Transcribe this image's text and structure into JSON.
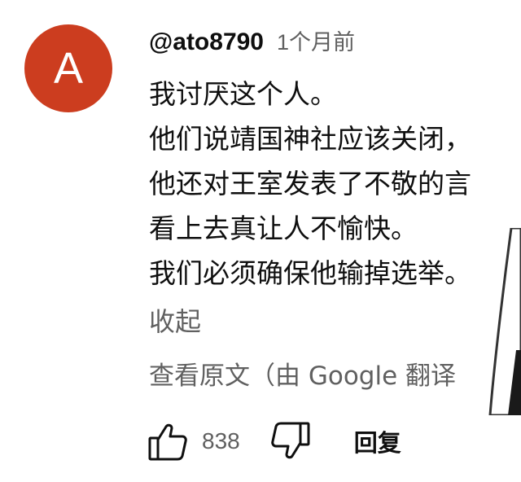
{
  "comment": {
    "avatar_letter": "A",
    "username": "@ato8790",
    "timestamp": "1个月前",
    "lines": [
      "我讨厌这个人。",
      "他们说靖国神社应该关闭，",
      "他还对王室发表了不敬的言",
      "看上去真让人不愉快。",
      "我们必须确保他输掉选举。"
    ],
    "collapse_label": "收起",
    "translate_label": "查看原文（由 Google 翻译",
    "like_count": "838",
    "reply_label": "回复"
  },
  "colors": {
    "avatar_bg": "#cc3d1f",
    "primary_text": "#0f0f0f",
    "secondary_text": "#606060"
  },
  "icons": [
    "thumbs-up-icon",
    "thumbs-down-icon"
  ]
}
